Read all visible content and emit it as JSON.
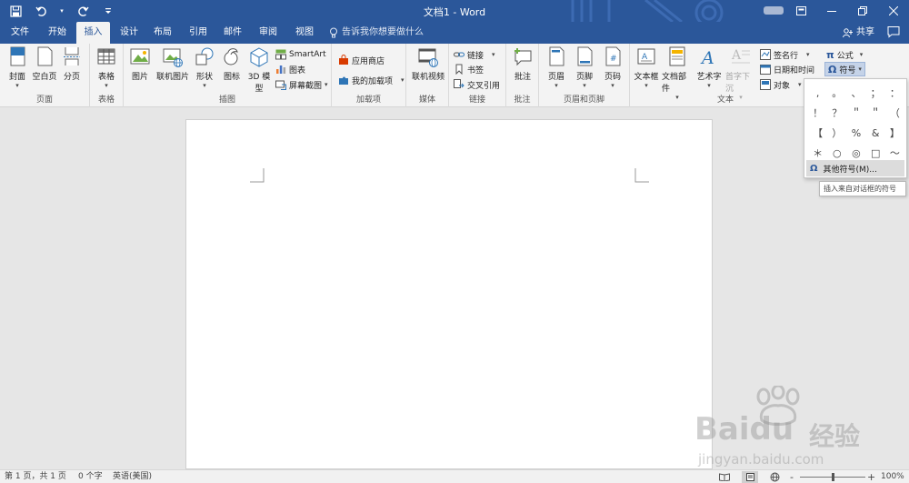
{
  "window": {
    "doc_title": "文档1  -  Word",
    "qat_icons": [
      "save-icon",
      "undo-icon",
      "redo-icon",
      "customize-qat-icon"
    ],
    "controls": [
      "ribbon-display-icon",
      "minimize-icon",
      "maximize-icon",
      "close-icon"
    ],
    "brand_color": "#2b579a"
  },
  "tabs": [
    {
      "label": "文件"
    },
    {
      "label": "开始"
    },
    {
      "label": "插入",
      "active": true
    },
    {
      "label": "设计"
    },
    {
      "label": "布局"
    },
    {
      "label": "引用"
    },
    {
      "label": "邮件"
    },
    {
      "label": "审阅"
    },
    {
      "label": "视图"
    }
  ],
  "tell_me": "告诉我你想要做什么",
  "share": "共享",
  "ribbon": {
    "pages": {
      "label": "页面",
      "cover": "封面",
      "blank": "空白页",
      "break": "分页"
    },
    "tables": {
      "label": "表格",
      "table": "表格"
    },
    "illustrations": {
      "label": "插图",
      "picture": "图片",
      "online_picture": "联机图片",
      "shapes": "形状",
      "icons": "图标",
      "model3d_1": "3D 模",
      "model3d_2": "型",
      "smartart": "SmartArt",
      "chart": "图表",
      "screenshot": "屏幕截图"
    },
    "addins": {
      "label": "加载项",
      "store": "应用商店",
      "my_addins": "我的加载项"
    },
    "media": {
      "label": "媒体",
      "online_video": "联机视频"
    },
    "links": {
      "label": "链接",
      "link": "链接",
      "bookmark": "书签",
      "cross_ref": "交叉引用"
    },
    "comments": {
      "label": "批注",
      "comment": "批注"
    },
    "header_footer": {
      "label": "页眉和页脚",
      "header": "页眉",
      "footer": "页脚",
      "page_number": "页码"
    },
    "text": {
      "label": "文本",
      "textbox": "文本框",
      "quick_parts": "文档部件",
      "wordart": "艺术字",
      "dropcap": "首字下沉",
      "signature": "签名行",
      "datetime": "日期和时间",
      "object": "对象"
    },
    "symbols": {
      "equation": "公式",
      "symbol": "符号"
    }
  },
  "symbol_dropdown": {
    "symbols": [
      ",",
      "。",
      "、",
      "；",
      "：",
      "！",
      "？",
      "＂",
      "＂",
      "（",
      "【",
      "）",
      "%",
      "&",
      "】",
      "＊",
      "○",
      "◎",
      "□",
      "～"
    ],
    "more_symbols": "其他符号(M)...",
    "tooltip": "插入来自对话框的符号"
  },
  "status": {
    "page": "第 1 页，共 1 页",
    "words": "0 个字",
    "language": "英语(美国)",
    "zoom": "100%",
    "zoom_minus": "-",
    "zoom_plus": "+",
    "zoom_fraction": 0.5
  },
  "watermark": {
    "logo": "Baidu",
    "brand": "经验",
    "url": "jingyan.baidu.com"
  }
}
